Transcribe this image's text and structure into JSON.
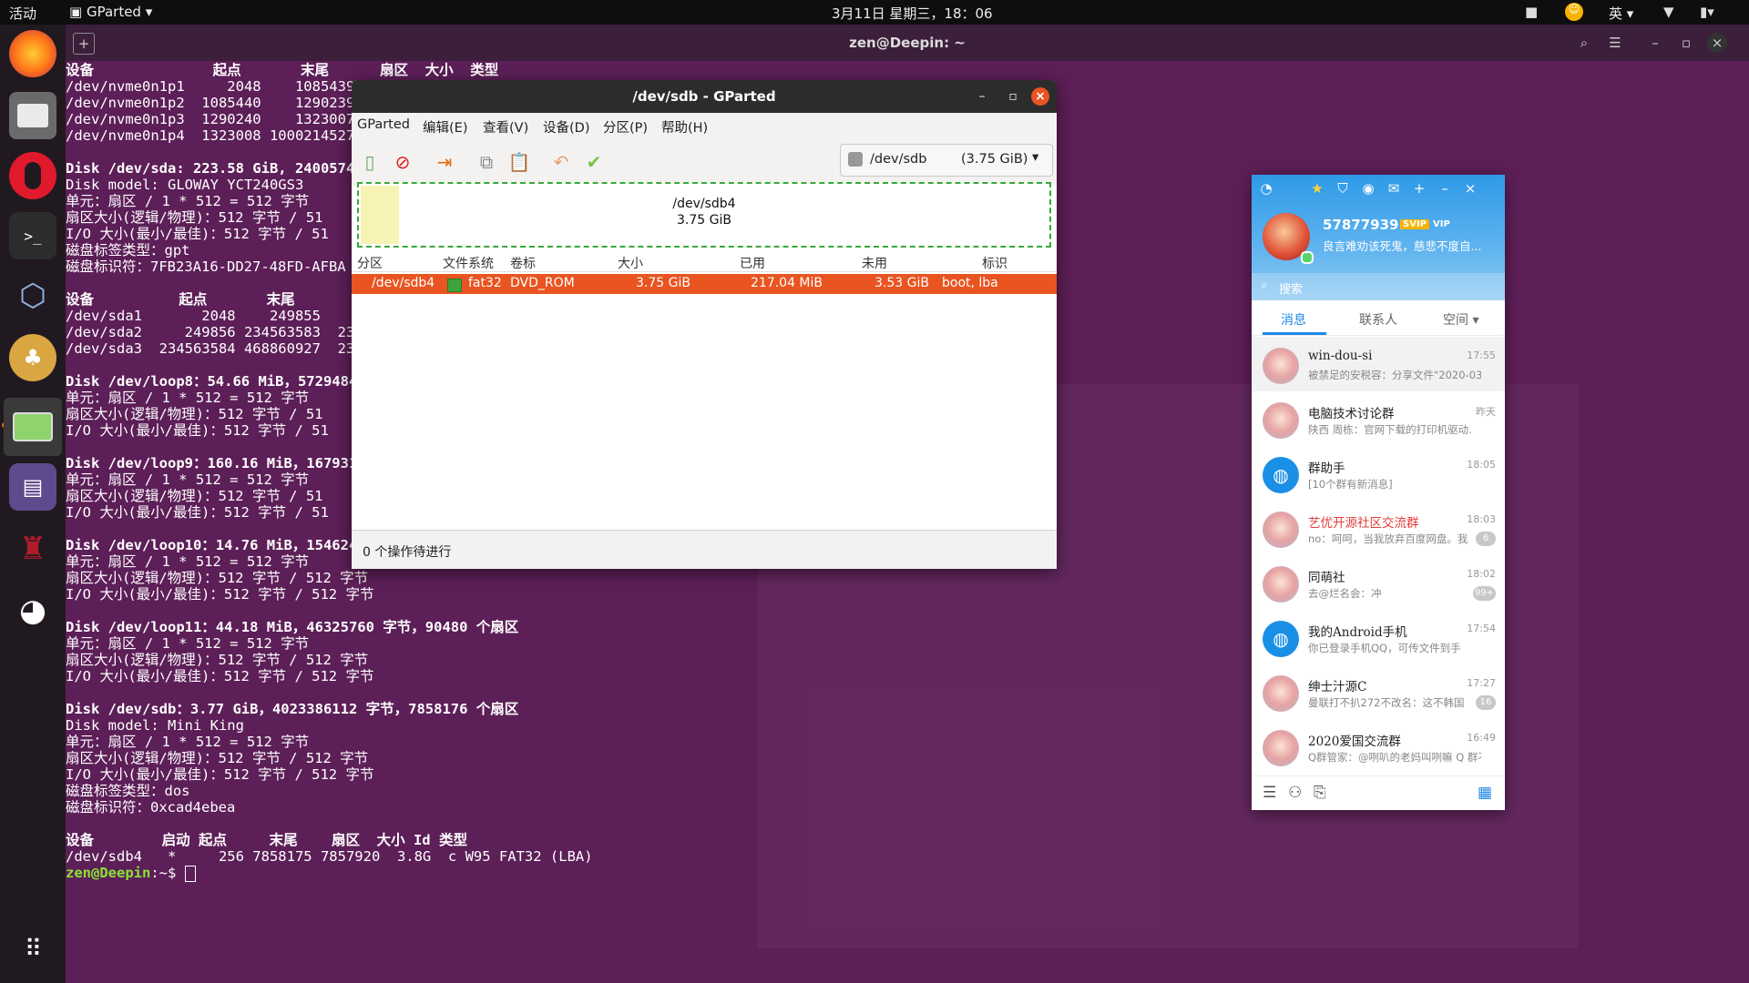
{
  "topbar": {
    "activities": "活动",
    "app_menu": "GParted",
    "clock": "3月11日 星期三，18：06",
    "input_method": "英"
  },
  "terminal": {
    "title": "zen@Deepin: ~",
    "prompt_user": "zen@Deepin",
    "prompt_rest": ":~$ ",
    "lines": [
      {
        "text": "设备              起点       末尾      扇区  大小  类型",
        "hdr": true
      },
      {
        "text": "/dev/nvme0n1p1     2048    1085439",
        "hdr": false
      },
      {
        "text": "/dev/nvme0n1p2  1085440    1290239",
        "hdr": false
      },
      {
        "text": "/dev/nvme0n1p3  1290240    1323007",
        "hdr": false
      },
      {
        "text": "/dev/nvme0n1p4  1323008 1000214527  9",
        "hdr": false
      },
      {
        "text": "",
        "hdr": false
      },
      {
        "text": "Disk /dev/sda: 223.58 GiB, 24005740",
        "hdr": true
      },
      {
        "text": "Disk model: GLOWAY YCT240GS3",
        "hdr": false
      },
      {
        "text": "单元：扇区 / 1 * 512 = 512 字节",
        "hdr": false
      },
      {
        "text": "扇区大小(逻辑/物理)：512 字节 / 51",
        "hdr": false
      },
      {
        "text": "I/O 大小(最小/最佳)：512 字节 / 51",
        "hdr": false
      },
      {
        "text": "磁盘标签类型：gpt",
        "hdr": false
      },
      {
        "text": "磁盘标识符：7FB23A16-DD27-48FD-AFBA",
        "hdr": false
      },
      {
        "text": "",
        "hdr": false
      },
      {
        "text": "设备          起点       末尾      ",
        "hdr": true
      },
      {
        "text": "/dev/sda1       2048    249855    2",
        "hdr": false
      },
      {
        "text": "/dev/sda2     249856 234563583  234",
        "hdr": false
      },
      {
        "text": "/dev/sda3  234563584 468860927  234",
        "hdr": false
      },
      {
        "text": "",
        "hdr": false
      },
      {
        "text": "Disk /dev/loop8：54.66 MiB，5729484",
        "hdr": true
      },
      {
        "text": "单元：扇区 / 1 * 512 = 512 字节",
        "hdr": false
      },
      {
        "text": "扇区大小(逻辑/物理)：512 字节 / 51",
        "hdr": false
      },
      {
        "text": "I/O 大小(最小/最佳)：512 字节 / 51",
        "hdr": false
      },
      {
        "text": "",
        "hdr": false
      },
      {
        "text": "Disk /dev/loop9：160.16 MiB，167931",
        "hdr": true
      },
      {
        "text": "单元：扇区 / 1 * 512 = 512 字节",
        "hdr": false
      },
      {
        "text": "扇区大小(逻辑/物理)：512 字节 / 51",
        "hdr": false
      },
      {
        "text": "I/O 大小(最小/最佳)：512 字节 / 51",
        "hdr": false
      },
      {
        "text": "",
        "hdr": false
      },
      {
        "text": "Disk /dev/loop10：14.76 MiB，15462400 字节，30200 个扇区",
        "hdr": true
      },
      {
        "text": "单元：扇区 / 1 * 512 = 512 字节",
        "hdr": false
      },
      {
        "text": "扇区大小(逻辑/物理)：512 字节 / 512 字节",
        "hdr": false
      },
      {
        "text": "I/O 大小(最小/最佳)：512 字节 / 512 字节",
        "hdr": false
      },
      {
        "text": "",
        "hdr": false
      },
      {
        "text": "Disk /dev/loop11：44.18 MiB，46325760 字节，90480 个扇区",
        "hdr": true
      },
      {
        "text": "单元：扇区 / 1 * 512 = 512 字节",
        "hdr": false
      },
      {
        "text": "扇区大小(逻辑/物理)：512 字节 / 512 字节",
        "hdr": false
      },
      {
        "text": "I/O 大小(最小/最佳)：512 字节 / 512 字节",
        "hdr": false
      },
      {
        "text": "",
        "hdr": false
      },
      {
        "text": "Disk /dev/sdb：3.77 GiB，4023386112 字节，7858176 个扇区",
        "hdr": true
      },
      {
        "text": "Disk model: Mini King",
        "hdr": false
      },
      {
        "text": "单元：扇区 / 1 * 512 = 512 字节",
        "hdr": false
      },
      {
        "text": "扇区大小(逻辑/物理)：512 字节 / 512 字节",
        "hdr": false
      },
      {
        "text": "I/O 大小(最小/最佳)：512 字节 / 512 字节",
        "hdr": false
      },
      {
        "text": "磁盘标签类型：dos",
        "hdr": false
      },
      {
        "text": "磁盘标识符：0xcad4ebea",
        "hdr": false
      },
      {
        "text": "",
        "hdr": false
      },
      {
        "text": "设备        启动 起点     末尾    扇区  大小 Id 类型",
        "hdr": true
      },
      {
        "text": "/dev/sdb4   *     256 7858175 7857920  3.8G  c W95 FAT32 (LBA)",
        "hdr": false
      }
    ]
  },
  "gparted": {
    "title": "/dev/sdb - GParted",
    "menu": [
      "GParted",
      "编辑(E)",
      "查看(V)",
      "设备(D)",
      "分区(P)",
      "帮助(H)"
    ],
    "device": "/dev/sdb",
    "device_size": "(3.75 GiB)",
    "disk_partition": "/dev/sdb4",
    "disk_size": "3.75 GiB",
    "columns": [
      "分区",
      "文件系统",
      "卷标",
      "大小",
      "已用",
      "未用",
      "标识"
    ],
    "row": {
      "partition": "/dev/sdb4",
      "fs": "fat32",
      "label": "DVD_ROM",
      "size": "3.75 GiB",
      "used": "217.04 MiB",
      "unused": "3.53 GiB",
      "flags": "boot, lba"
    },
    "status": "0 个操作待进行"
  },
  "qq": {
    "nickname": "578779391",
    "vip1": "SVIP",
    "vip2": "VIP",
    "signature": "良言难劝该死鬼，慈悲不度自...",
    "search_placeholder": "搜索",
    "tabs": [
      "消息",
      "联系人",
      "空间"
    ],
    "chats": [
      {
        "name": "win-dou-si",
        "msg": "被禁足的安税容：分享文件\"2020-03-",
        "time": "17:55",
        "badge": "",
        "red": false,
        "blue": false
      },
      {
        "name": "电脑技术讨论群",
        "msg": "陕西  周栋：官网下载的打印机驱动.",
        "time": "昨天",
        "badge": "",
        "red": false,
        "blue": false
      },
      {
        "name": "群助手",
        "msg": "[10个群有新消息]",
        "time": "18:05",
        "badge": "",
        "red": false,
        "blue": true
      },
      {
        "name": "艺优开源社区交流群",
        "msg": "no：呵呵，当我放弃百度网盘。我",
        "time": "18:03",
        "badge": "6",
        "red": true,
        "blue": false
      },
      {
        "name": "同萌社",
        "msg": "去@烂名会：冲",
        "time": "18:02",
        "badge": "99+",
        "red": false,
        "blue": false
      },
      {
        "name": "我的Android手机",
        "msg": "你已登录手机QQ，可传文件到手",
        "time": "17:54",
        "badge": "",
        "red": false,
        "blue": true
      },
      {
        "name": "绅士汁源C",
        "msg": "曼联打不扒272不改名：这不韩国",
        "time": "17:27",
        "badge": "16",
        "red": false,
        "blue": false
      },
      {
        "name": "2020爱国交流群",
        "msg": "Q群管家：@咧叭的老妈叫咧嘛 Q 群不",
        "time": "16:49",
        "badge": "",
        "red": false,
        "blue": false
      }
    ]
  },
  "colors": {
    "accent": "#e95420",
    "terminal_bg": "#5e205a",
    "qq_blue": "#1e8ae6"
  },
  "icons": {
    "dock": [
      "firefox-icon",
      "files-icon",
      "opera-icon",
      "terminal-icon",
      "virtualbox-icon",
      "app-icon",
      "gparted-icon",
      "video-icon",
      "wine-icon",
      "qq-icon"
    ]
  }
}
